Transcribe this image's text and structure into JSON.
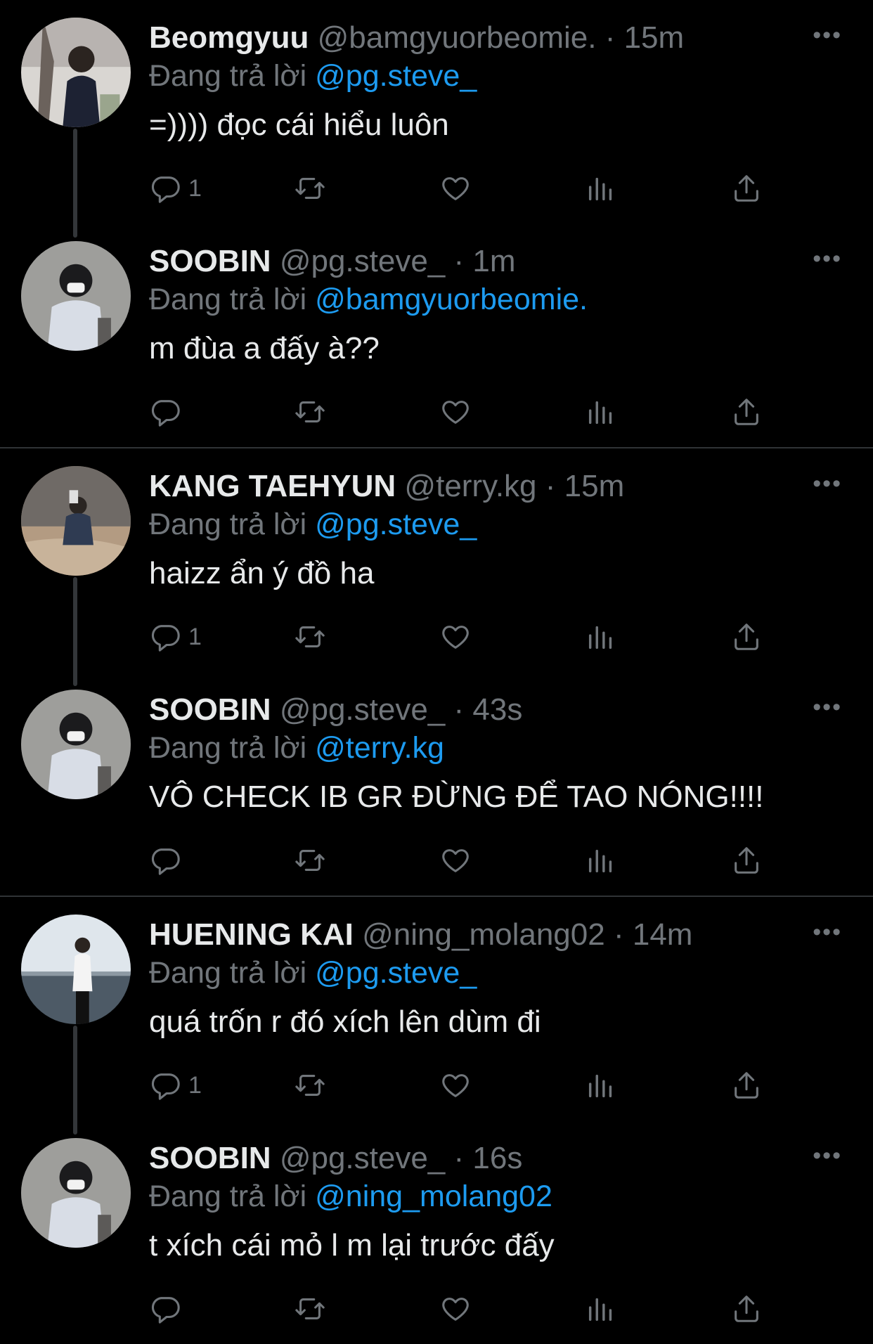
{
  "reply_prefix": "Đang trả lời",
  "more_label": "•••",
  "colors": {
    "background": "#000000",
    "mention": "#1d9bf0",
    "muted": "#71767b",
    "text": "#e7e9ea",
    "divider": "#2f3336"
  },
  "threads": [
    {
      "tweets": [
        {
          "name": "Beomgyuu",
          "handle": "@bamgyuorbeomie.",
          "dot": "·",
          "time": "15m",
          "reply_to": "@pg.steve_",
          "text": "=)))) đọc cái hiểu luôn",
          "reply_count": "1"
        },
        {
          "name": "SOOBIN",
          "handle": "@pg.steve_",
          "dot": "·",
          "time": "1m",
          "reply_to": "@bamgyuorbeomie.",
          "text": "m đùa a đấy à??",
          "reply_count": ""
        }
      ]
    },
    {
      "tweets": [
        {
          "name": "KANG TAEHYUN",
          "handle": "@terry.kg",
          "dot": "·",
          "time": "15m",
          "reply_to": "@pg.steve_",
          "text": "haizz ẩn ý đồ ha",
          "reply_count": "1"
        },
        {
          "name": "SOOBIN",
          "handle": "@pg.steve_",
          "dot": "·",
          "time": "43s",
          "reply_to": "@terry.kg",
          "text": "VÔ CHECK IB GR ĐỪNG ĐỂ TAO NÓNG!!!!",
          "reply_count": ""
        }
      ]
    },
    {
      "tweets": [
        {
          "name": "HUENING KAI",
          "handle": "@ning_molang02",
          "dot": "·",
          "time": "14m",
          "reply_to": "@pg.steve_",
          "text": "quá trốn r đó xích lên dùm đi",
          "reply_count": "1"
        },
        {
          "name": "SOOBIN",
          "handle": "@pg.steve_",
          "dot": "·",
          "time": "16s",
          "reply_to": "@ning_molang02",
          "text": "t xích cái mỏ l m lại trước đấy",
          "reply_count": ""
        }
      ]
    }
  ],
  "icons": {
    "reply": "reply-icon",
    "retweet": "retweet-icon",
    "like": "like-icon",
    "views": "views-icon",
    "share": "share-icon",
    "more": "more-icon"
  }
}
